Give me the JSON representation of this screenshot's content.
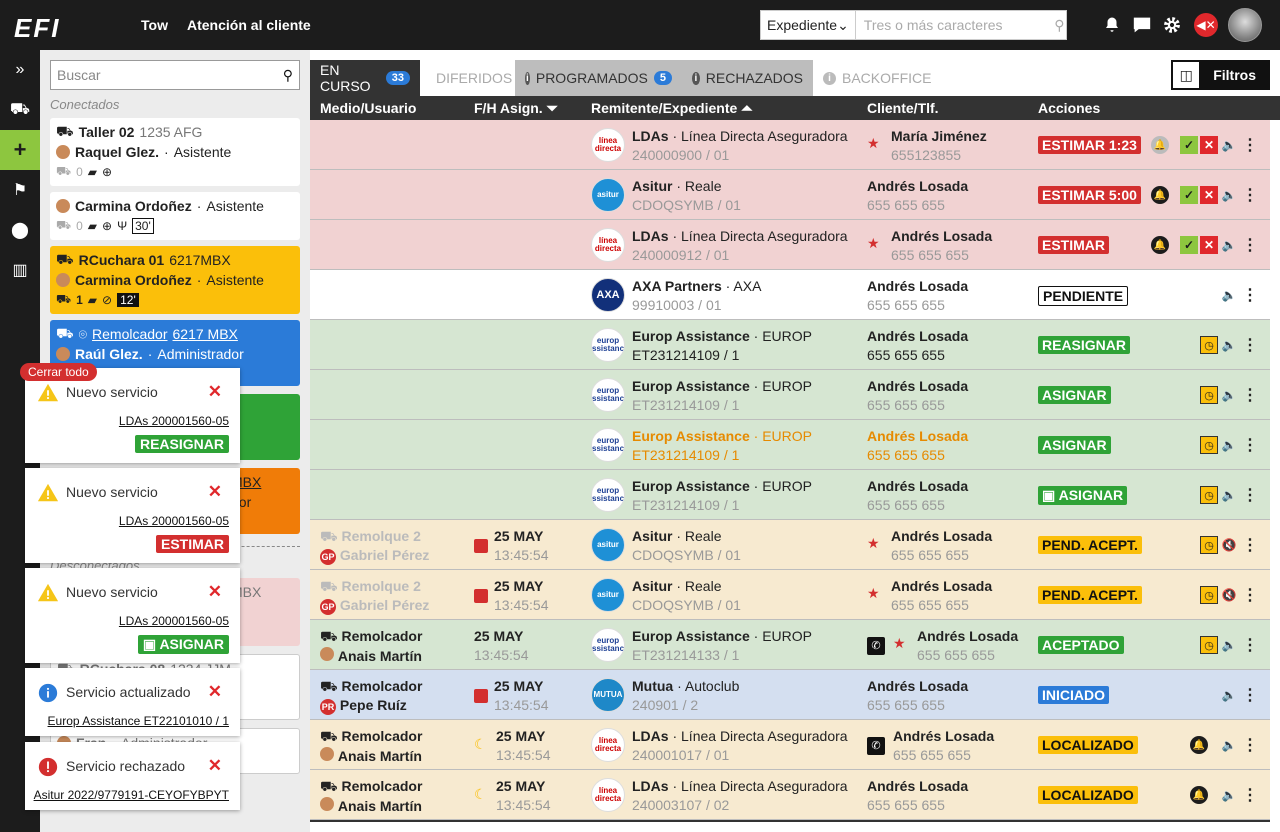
{
  "topbar": {
    "logo": "EFI",
    "nav": [
      "Tow",
      "Atención al cliente"
    ],
    "search_select": "Expediente",
    "search_placeholder": "Tres o más caracteres"
  },
  "sidebar": {
    "search_placeholder": "Buscar",
    "section_connected": "Conectados",
    "section_disconnected": "Desconectados",
    "cards": [
      {
        "vehicle": "Taller 02",
        "plate": "1235 AFG",
        "user": "Raquel Glez.",
        "role": "Asistente",
        "count": "0"
      },
      {
        "user": "Carmina Ordoñez",
        "role": "Asistente",
        "count": "0",
        "time": "30'"
      },
      {
        "vehicle": "RCuchara 01",
        "plate": "6217MBX",
        "user": "Carmina Ordoñez",
        "role": "Asistente",
        "count": "1",
        "time": "12'"
      },
      {
        "vehicle": "Remolcador",
        "plate": "6217 MBX",
        "user": "Raúl Glez.",
        "role": "Administrador"
      },
      {
        "partial": "MBX",
        "partial2": "dor"
      },
      {
        "partial": "MBX",
        "partial2": "r"
      },
      {
        "vehicle": "RCuchara 08",
        "plate": "1234 JJM"
      },
      {
        "user": "Fran",
        "role": "Administrador"
      }
    ]
  },
  "toasts": {
    "close_all": "Cerrar todo",
    "items": [
      {
        "title": "Nuevo servicio",
        "link": "LDAs 200001560-05",
        "button": "REASIGNAR"
      },
      {
        "title": "Nuevo servicio",
        "link": "LDAs 200001560-05",
        "button": "ESTIMAR"
      },
      {
        "title": "Nuevo servicio",
        "link": "LDAs 200001560-05",
        "button": "ASIGNAR"
      },
      {
        "title": "Servicio actualizado",
        "link": "Europ Assistance ET22101010 / 1"
      },
      {
        "title": "Servicio rechazado",
        "link": "Asitur 2022/9779191-CEYOFYBPYT"
      }
    ]
  },
  "tabs": [
    {
      "label": "EN CURSO",
      "badge": "33"
    },
    {
      "label": "DIFERIDOS"
    },
    {
      "label": "PROGRAMADOS",
      "badge": "5"
    },
    {
      "label": "RECHAZADOS"
    },
    {
      "label": "BACKOFFICE"
    }
  ],
  "filters_label": "Filtros",
  "columns": [
    "Medio/Usuario",
    "F/H Asign.",
    "Remitente/Expediente",
    "Cliente/Tlf.",
    "Acciones"
  ],
  "rows": [
    {
      "sender": "LDAs",
      "company": "Línea Directa Aseguradora",
      "file": "240000900 / 01",
      "client": "María Jiménez",
      "phone": "655123855",
      "status": "ESTIMAR 1:23"
    },
    {
      "sender": "Asitur",
      "company": "Reale",
      "file": "CDOQSYMB / 01",
      "client": "Andrés Losada",
      "phone": "655 655 655",
      "status": "ESTIMAR 5:00"
    },
    {
      "sender": "LDAs",
      "company": "Línea Directa Aseguradora",
      "file": "240000912 / 01",
      "client": "Andrés Losada",
      "phone": "655 655 655",
      "status": "ESTIMAR"
    },
    {
      "sender": "AXA Partners",
      "company": "AXA",
      "file": "99910003 / 01",
      "client": "Andrés Losada",
      "phone": "655 655 655",
      "status": "PENDIENTE"
    },
    {
      "sender": "Europ Assistance",
      "company": "EUROP",
      "file": "ET231214109 / 1",
      "client": "Andrés Losada",
      "phone": "655 655 655",
      "status": "REASIGNAR"
    },
    {
      "sender": "Europ Assistance",
      "company": "EUROP",
      "file": "ET231214109 / 1",
      "client": "Andrés Losada",
      "phone": "655 655 655",
      "status": "ASIGNAR"
    },
    {
      "sender": "Europ Assistance",
      "company": "EUROP",
      "file": "ET231214109 / 1",
      "client": "Andrés Losada",
      "phone": "655 655 655",
      "status": "ASIGNAR"
    },
    {
      "sender": "Europ Assistance",
      "company": "EUROP",
      "file": "ET231214109 / 1",
      "client": "Andrés Losada",
      "phone": "655 655 655",
      "status": "ASIGNAR"
    },
    {
      "vehicle": "Remolque 2",
      "user": "Gabriel Pérez",
      "initials": "GP",
      "date": "25 MAY",
      "time": "13:45:54",
      "sender": "Asitur",
      "company": "Reale",
      "file": "CDOQSYMB / 01",
      "client": "Andrés Losada",
      "phone": "655 655 655",
      "status": "PEND. ACEPT."
    },
    {
      "vehicle": "Remolque 2",
      "user": "Gabriel Pérez",
      "initials": "GP",
      "date": "25 MAY",
      "time": "13:45:54",
      "sender": "Asitur",
      "company": "Reale",
      "file": "CDOQSYMB / 01",
      "client": "Andrés Losada",
      "phone": "655 655 655",
      "status": "PEND. ACEPT."
    },
    {
      "vehicle": "Remolcador",
      "user": "Anais Martín",
      "date": "25 MAY",
      "time": "13:45:54",
      "sender": "Europ Assistance",
      "company": "EUROP",
      "file": "ET231214133 / 1",
      "client": "Andrés Losada",
      "phone": "655 655 655",
      "status": "ACEPTADO"
    },
    {
      "vehicle": "Remolcador",
      "user": "Pepe Ruíz",
      "initials": "PR",
      "date": "25 MAY",
      "time": "13:45:54",
      "sender": "Mutua",
      "company": "Autoclub",
      "file": "240901 / 2",
      "client": "Andrés Losada",
      "phone": "655 655 655",
      "status": "INICIADO"
    },
    {
      "vehicle": "Remolcador",
      "user": "Anais Martín",
      "date": "25 MAY",
      "time": "13:45:54",
      "sender": "LDAs",
      "company": "Línea Directa Aseguradora",
      "file": "240001017 / 01",
      "client": "Andrés Losada",
      "phone": "655 655 655",
      "status": "LOCALIZADO"
    },
    {
      "vehicle": "Remolcador",
      "user": "Anais Martín",
      "date": "25 MAY",
      "time": "13:45:54",
      "sender": "LDAs",
      "company": "Línea Directa Aseguradora",
      "file": "240003107 / 02",
      "client": "Andrés Losada",
      "phone": "655 655 655",
      "status": "LOCALIZADO"
    }
  ],
  "logo_texts": {
    "ld": "línea directa",
    "as": "asitur",
    "axa": "AXA",
    "eu": "europ assistance",
    "mu": "MUTUA"
  }
}
